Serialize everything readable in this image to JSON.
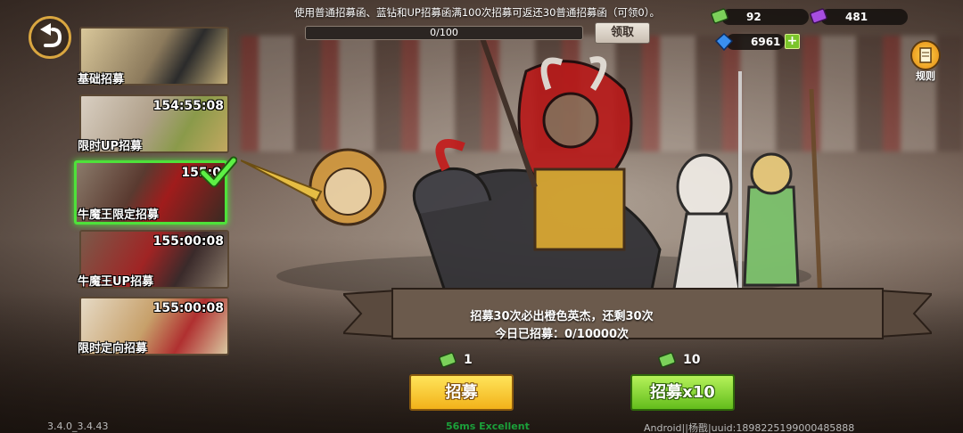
{
  "header": {
    "info_text": "使用普通招募函、蓝钻和UP招募函满100次招募可返还30普通招募函（可领0）。",
    "progress_text": "0/100",
    "progress_value": 0,
    "claim_label": "领取"
  },
  "currencies": {
    "scroll_green": {
      "value": "92",
      "icon": "green-scroll-icon"
    },
    "scroll_purple": {
      "value": "481",
      "icon": "purple-scroll-icon"
    },
    "diamond": {
      "value": "6961",
      "icon": "blue-diamond-icon"
    },
    "add_label": "+"
  },
  "rules": {
    "label": "规则"
  },
  "banners": [
    {
      "label": "基础招募",
      "timer": ""
    },
    {
      "label": "限时UP招募",
      "timer": "154:55:08"
    },
    {
      "label": "牛魔王限定招募",
      "timer": "155:0",
      "selected": true
    },
    {
      "label": "牛魔王UP招募",
      "timer": "155:00:08"
    },
    {
      "label": "限时定向招募",
      "timer": "155:00:08"
    }
  ],
  "scroll": {
    "line1": "招募30次必出橙色英杰，还剩30次",
    "line2": "今日已招募：0/10000次"
  },
  "recruit": {
    "single_cost": "1",
    "single_label": "招募",
    "multi_cost": "10",
    "multi_label": "招募x10"
  },
  "footer": {
    "version": "3.4.0_3.4.43",
    "ping": "56ms Excellent",
    "device": "Android||杨戬|uuid:1898225199000485888"
  },
  "colors": {
    "accent_green": "#4ee13a",
    "button_yellow": "#f2b21a",
    "button_green": "#63bd1c"
  }
}
